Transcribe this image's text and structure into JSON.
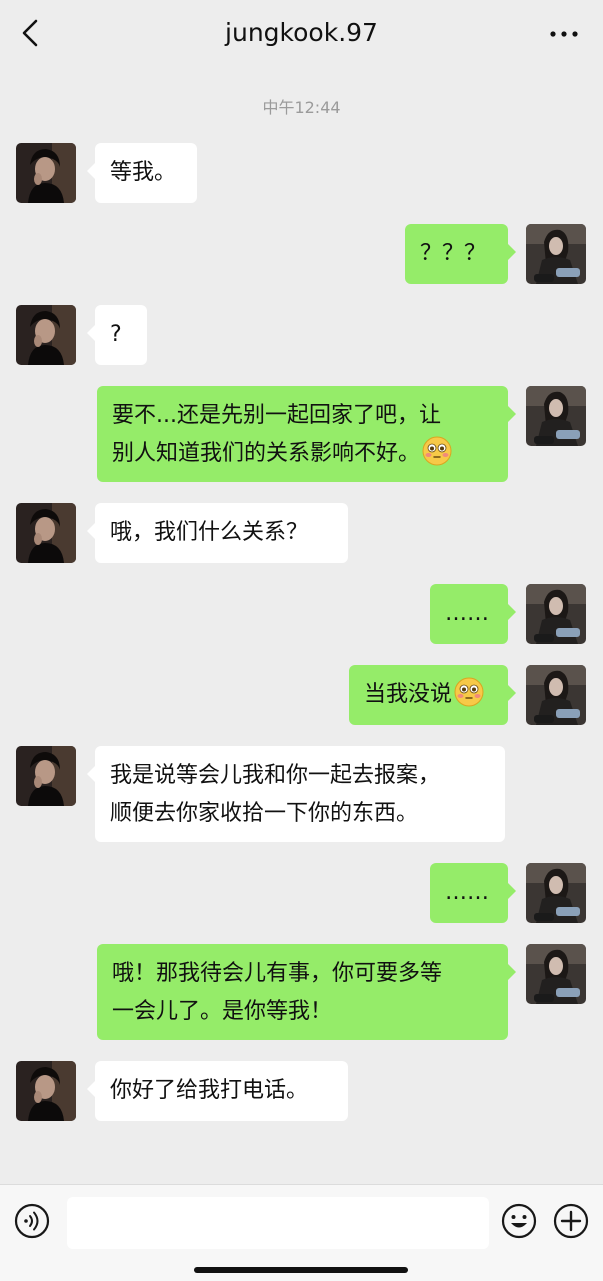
{
  "header": {
    "title": "jungkook.97",
    "back_icon": "chevron-left-icon",
    "more_icon": "more-dots-icon"
  },
  "timestamp": "中午12:44",
  "messages": [
    {
      "side": "in",
      "text": "等我。"
    },
    {
      "side": "out",
      "text": "？？？"
    },
    {
      "side": "in",
      "text": "?"
    },
    {
      "side": "out",
      "lines": [
        "要不...还是先别一起回家了吧，让",
        "别人知道我们的关系影响不好。"
      ],
      "emoji": "flushed-face-emoji"
    },
    {
      "side": "in",
      "text": "哦，我们什么关系？"
    },
    {
      "side": "out",
      "text": "……"
    },
    {
      "side": "out",
      "text": "当我没说",
      "emoji": "flushed-face-emoji"
    },
    {
      "side": "in",
      "lines": [
        "我是说等会儿我和你一起去报案，",
        "顺便去你家收拾一下你的东西。"
      ]
    },
    {
      "side": "out",
      "text": "……"
    },
    {
      "side": "out",
      "lines": [
        "哦！那我待会儿有事，你可要多等",
        "一会儿了。是你等我！"
      ]
    },
    {
      "side": "in",
      "text": "你好了给我打电话。"
    }
  ],
  "footer": {
    "input_value": "",
    "voice_icon": "voice-icon",
    "emoji_icon": "emoji-smile-icon",
    "plus_icon": "plus-circle-icon"
  },
  "colors": {
    "background": "#ededed",
    "outgoing_bubble": "#95ec69",
    "incoming_bubble": "#ffffff",
    "timestamp_text": "#9b9b9b"
  }
}
